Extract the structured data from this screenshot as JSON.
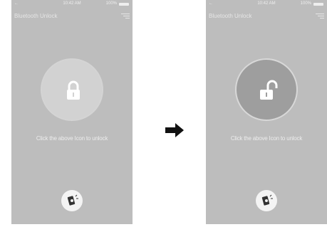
{
  "phones": {
    "before": {
      "status": {
        "left": "←",
        "time": "10:42 AM",
        "battery": "100%"
      },
      "title": "Bluetooth Unlock",
      "hint": "Click the above Icon to unlock",
      "lock_state": "locked"
    },
    "after": {
      "status": {
        "left": "←",
        "time": "10:42 AM",
        "battery": "100%"
      },
      "title": "Bluetooth Unlock",
      "hint": "Click the above Icon to unlock",
      "lock_state": "unlocked"
    }
  },
  "icons": {
    "lock_button": "padlock-closed-icon",
    "unlock_button": "padlock-open-icon",
    "bluetooth_button": "phone-shake-icon",
    "menu": "menu-icon",
    "transition": "arrow-right-icon"
  },
  "colors": {
    "screen_bg": "#bdbdbd",
    "locked_circle": "#d2d2d2",
    "unlocked_circle": "#9e9e9e",
    "text": "#ededed",
    "arrow": "#111111"
  }
}
